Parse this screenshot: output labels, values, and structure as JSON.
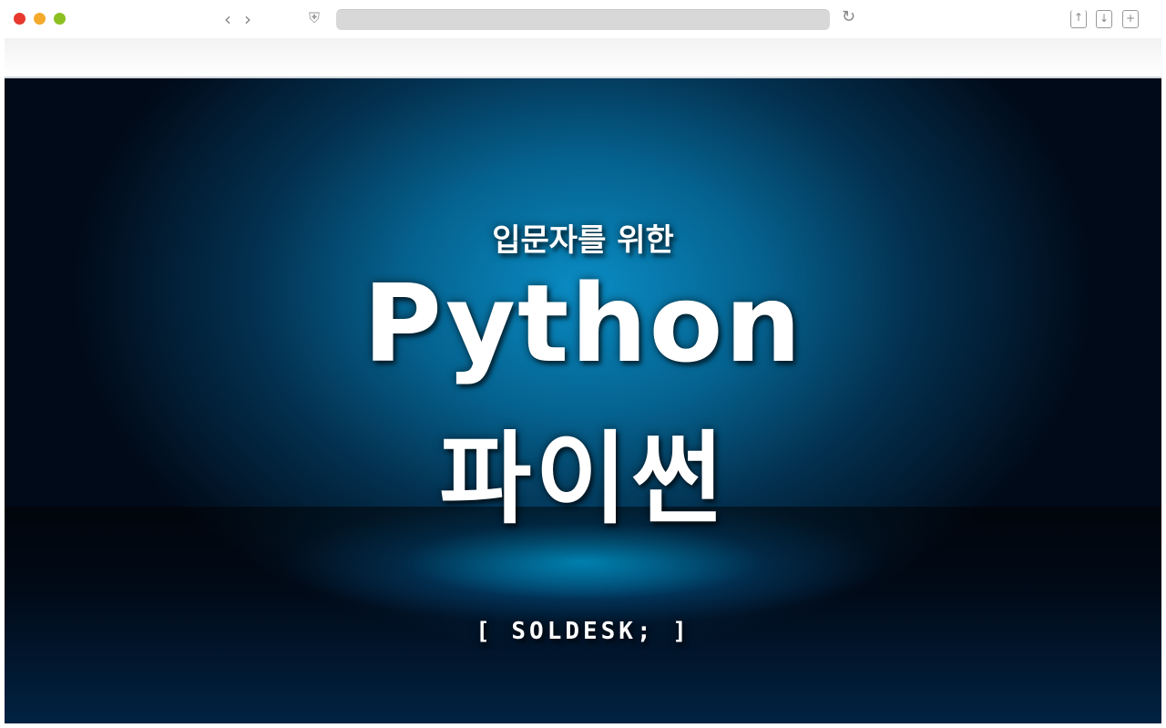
{
  "browser": {
    "url": ""
  },
  "hero": {
    "subtitle": "입문자를 위한",
    "title_en": "Python",
    "title_ko": "파이썬",
    "logo": "[ SOLDESK; ]"
  }
}
